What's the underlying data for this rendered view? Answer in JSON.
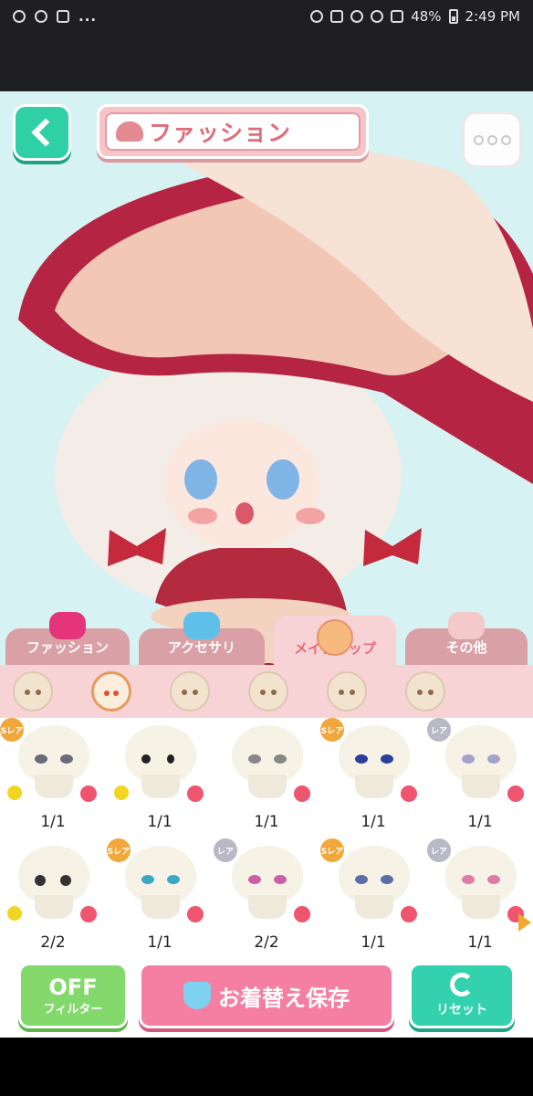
{
  "status_bar": {
    "overflow": "...",
    "battery": "48%",
    "time": "2:49 PM"
  },
  "header": {
    "category_label": "ファッション"
  },
  "tabs": [
    {
      "label": "ファッション",
      "active": false
    },
    {
      "label": "アクセサリ",
      "active": false
    },
    {
      "label": "メイクアップ",
      "active": true
    },
    {
      "label": "その他",
      "active": false
    }
  ],
  "sub_tabs": [
    "face-1",
    "face-2",
    "face-3",
    "face-4",
    "face-5",
    "face-6"
  ],
  "items": [
    {
      "badge": "Sレア",
      "count": "1/1"
    },
    {
      "badge": "",
      "count": "1/1"
    },
    {
      "badge": "",
      "count": "1/1"
    },
    {
      "badge": "Sレア",
      "count": "1/1"
    },
    {
      "badge": "レア",
      "count": "1/1"
    },
    {
      "badge": "",
      "count": "2/2"
    },
    {
      "badge": "Sレア",
      "count": "1/1"
    },
    {
      "badge": "レア",
      "count": "2/2"
    },
    {
      "badge": "Sレア",
      "count": "1/1"
    },
    {
      "badge": "レア",
      "count": "1/1"
    }
  ],
  "bottom": {
    "filter_big": "OFF",
    "filter_small": "フィルター",
    "save_label": "お着替え保存",
    "reset_label": "リセット"
  }
}
